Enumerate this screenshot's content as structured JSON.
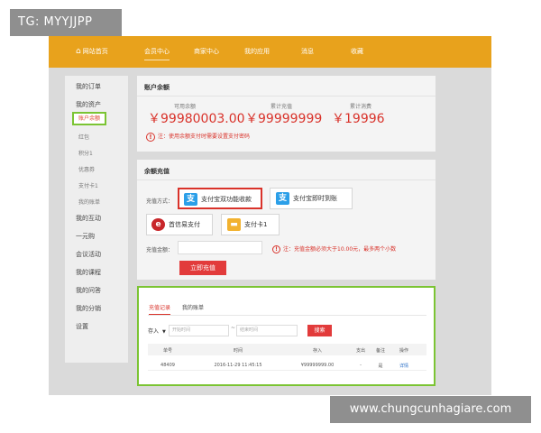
{
  "watermarks": {
    "top": "TG: MYYJJPP",
    "bottom": "www.chungcunhagiare.com"
  },
  "topnav": {
    "home_icon": "home-icon",
    "items": [
      "网站首页",
      "会员中心",
      "商家中心",
      "我的应用",
      "消息",
      "收藏"
    ],
    "active": "会员中心"
  },
  "sidebar": {
    "items": [
      "我的订单",
      "我的资产",
      "账户余额",
      "红包",
      "积分1",
      "优惠券",
      "支付卡1",
      "我的账单",
      "我的互动",
      "一元购",
      "会议活动",
      "我的课程",
      "我的问答",
      "我的分销",
      "设置"
    ],
    "selected": "账户余额"
  },
  "balance": {
    "title": "账户余额",
    "stats": [
      {
        "label": "可用余额",
        "value": "￥99980003.00"
      },
      {
        "label": "累计充值",
        "value": "￥99999999"
      },
      {
        "label": "累计消费",
        "value": "￥19996"
      }
    ],
    "note": "注：使用余额支付时需要设置支付密码"
  },
  "recharge": {
    "title": "余额充值",
    "method_label": "充值方式：",
    "methods": [
      {
        "label": "支付宝双功能收款",
        "icon": "alipay-icon",
        "selected": true
      },
      {
        "label": "支付宝即时到账",
        "icon": "alipay-icon",
        "selected": false
      },
      {
        "label": "首信易支付",
        "icon": "payease-icon",
        "selected": false
      },
      {
        "label": "支付卡1",
        "icon": "card-icon",
        "selected": false
      }
    ],
    "amount_label": "充值金额：",
    "amount_value": "",
    "amount_note": "注：充值金额必须大于10.00元，最多两个小数",
    "submit": "立即充值"
  },
  "records": {
    "tabs": [
      "充值记录",
      "我的账单"
    ],
    "active_tab": "充值记录",
    "filter": {
      "type": "存入",
      "start_placeholder": "开始时间",
      "end_placeholder": "结束时间",
      "separator": "~",
      "search": "搜索"
    },
    "columns": [
      "单号",
      "时间",
      "存入",
      "支出",
      "备注",
      "操作"
    ],
    "rows": [
      {
        "id": "48409",
        "time": "2016-11-29 11:45:15",
        "deposit": "¥99999999.00",
        "expense": "-",
        "remark": "是",
        "action": "详情"
      }
    ]
  },
  "colors": {
    "nav": "#e8a21c",
    "accent": "#d9322a",
    "highlight": "#7bc433"
  }
}
